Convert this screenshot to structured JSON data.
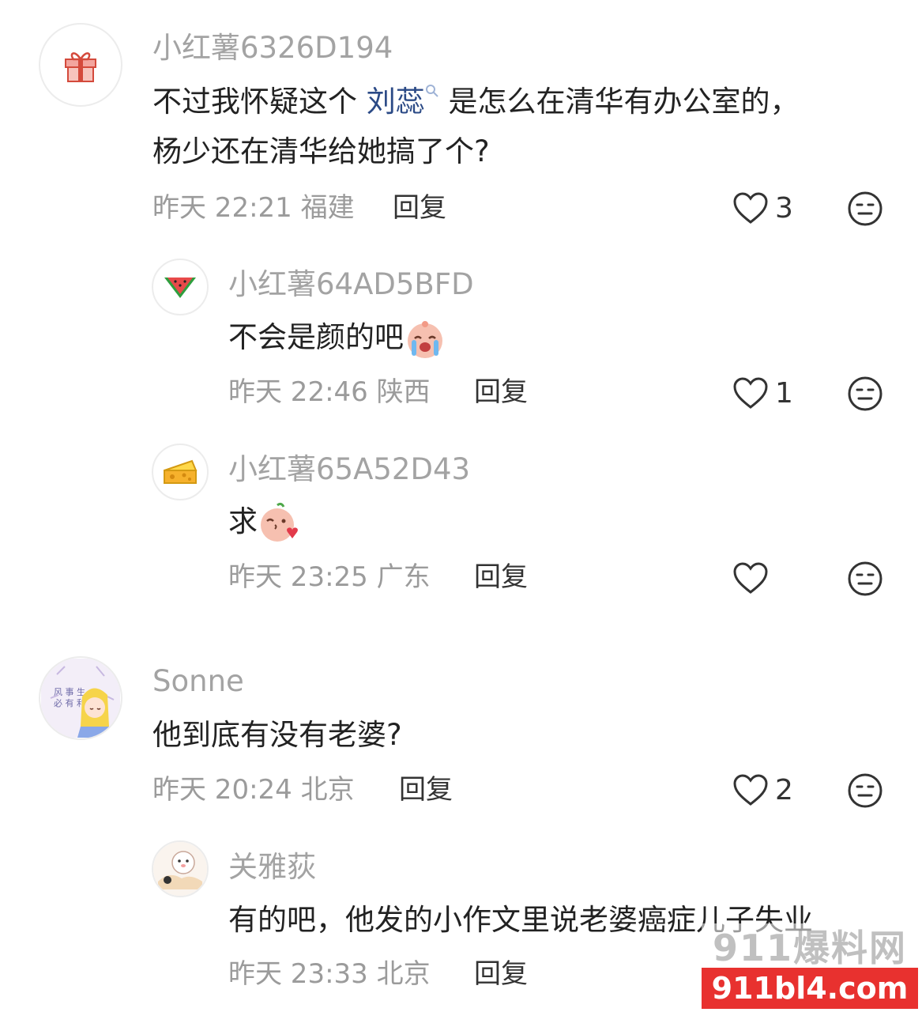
{
  "comments": [
    {
      "username": "小红薯6326D194",
      "text_before": "不过我怀疑这个",
      "link_text": "刘蕊",
      "text_after": "是怎么在清华有办公室的，",
      "text_line2": "杨少还在清华给她搞了个?",
      "time": "昨天 22:21",
      "location": "福建",
      "reply_label": "回复",
      "likes": "3",
      "avatar_icon": "gift-icon"
    },
    {
      "username": "小红薯64AD5BFD",
      "text": "不会是颜的吧",
      "time": "昨天 22:46",
      "location": "陕西",
      "reply_label": "回复",
      "likes": "1",
      "avatar_icon": "watermelon-icon"
    },
    {
      "username": "小红薯65A52D43",
      "text": "求",
      "time": "昨天 23:25",
      "location": "广东",
      "reply_label": "回复",
      "likes": "",
      "avatar_icon": "cheese-icon"
    },
    {
      "username": "Sonne",
      "text": "他到底有没有老婆?",
      "time": "昨天 20:24",
      "location": "北京",
      "reply_label": "回复",
      "likes": "2",
      "avatar_icon": "anime-girl-avatar"
    },
    {
      "username": "关雅荻",
      "text": "有的吧，他发的小作文里说老婆癌症儿子失业",
      "time": "昨天 23:33",
      "location": "北京",
      "reply_label": "回复",
      "likes": "",
      "avatar_icon": "cartoon-avatar"
    }
  ],
  "watermark": {
    "top_text": "911爆料网",
    "bottom_text": "911bl4.com"
  },
  "colors": {
    "link": "#2b4a86",
    "username": "#a3a3a3",
    "meta": "#9b9b9b",
    "watermark_red": "#e8312f"
  }
}
